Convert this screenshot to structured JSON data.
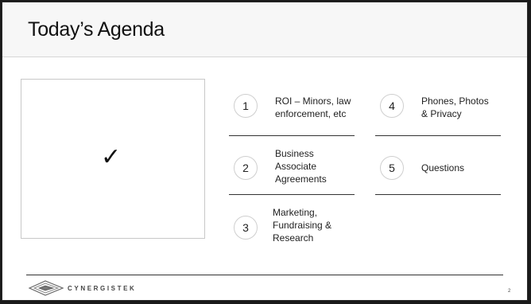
{
  "slide": {
    "title": "Today’s Agenda",
    "check_glyph": "✓",
    "items": [
      {
        "number": "1",
        "label_lines": [
          "ROI – Minors, law",
          "enforcement, etc"
        ]
      },
      {
        "number": "2",
        "label_lines": [
          "Business",
          "Associate",
          "Agreements"
        ]
      },
      {
        "number": "3",
        "label_lines": [
          "Marketing,",
          "Fundraising &",
          "Research"
        ]
      },
      {
        "number": "4",
        "label_lines": [
          "Phones, Photos",
          "& Privacy"
        ]
      },
      {
        "number": "5",
        "label_lines": [
          "Questions"
        ]
      }
    ],
    "footer": {
      "logo_text": "CYNERGISTEK",
      "page_number": "2"
    }
  },
  "colors": {
    "title_band": "#f7f7f7",
    "text": "#222222",
    "separator": "#333333"
  }
}
